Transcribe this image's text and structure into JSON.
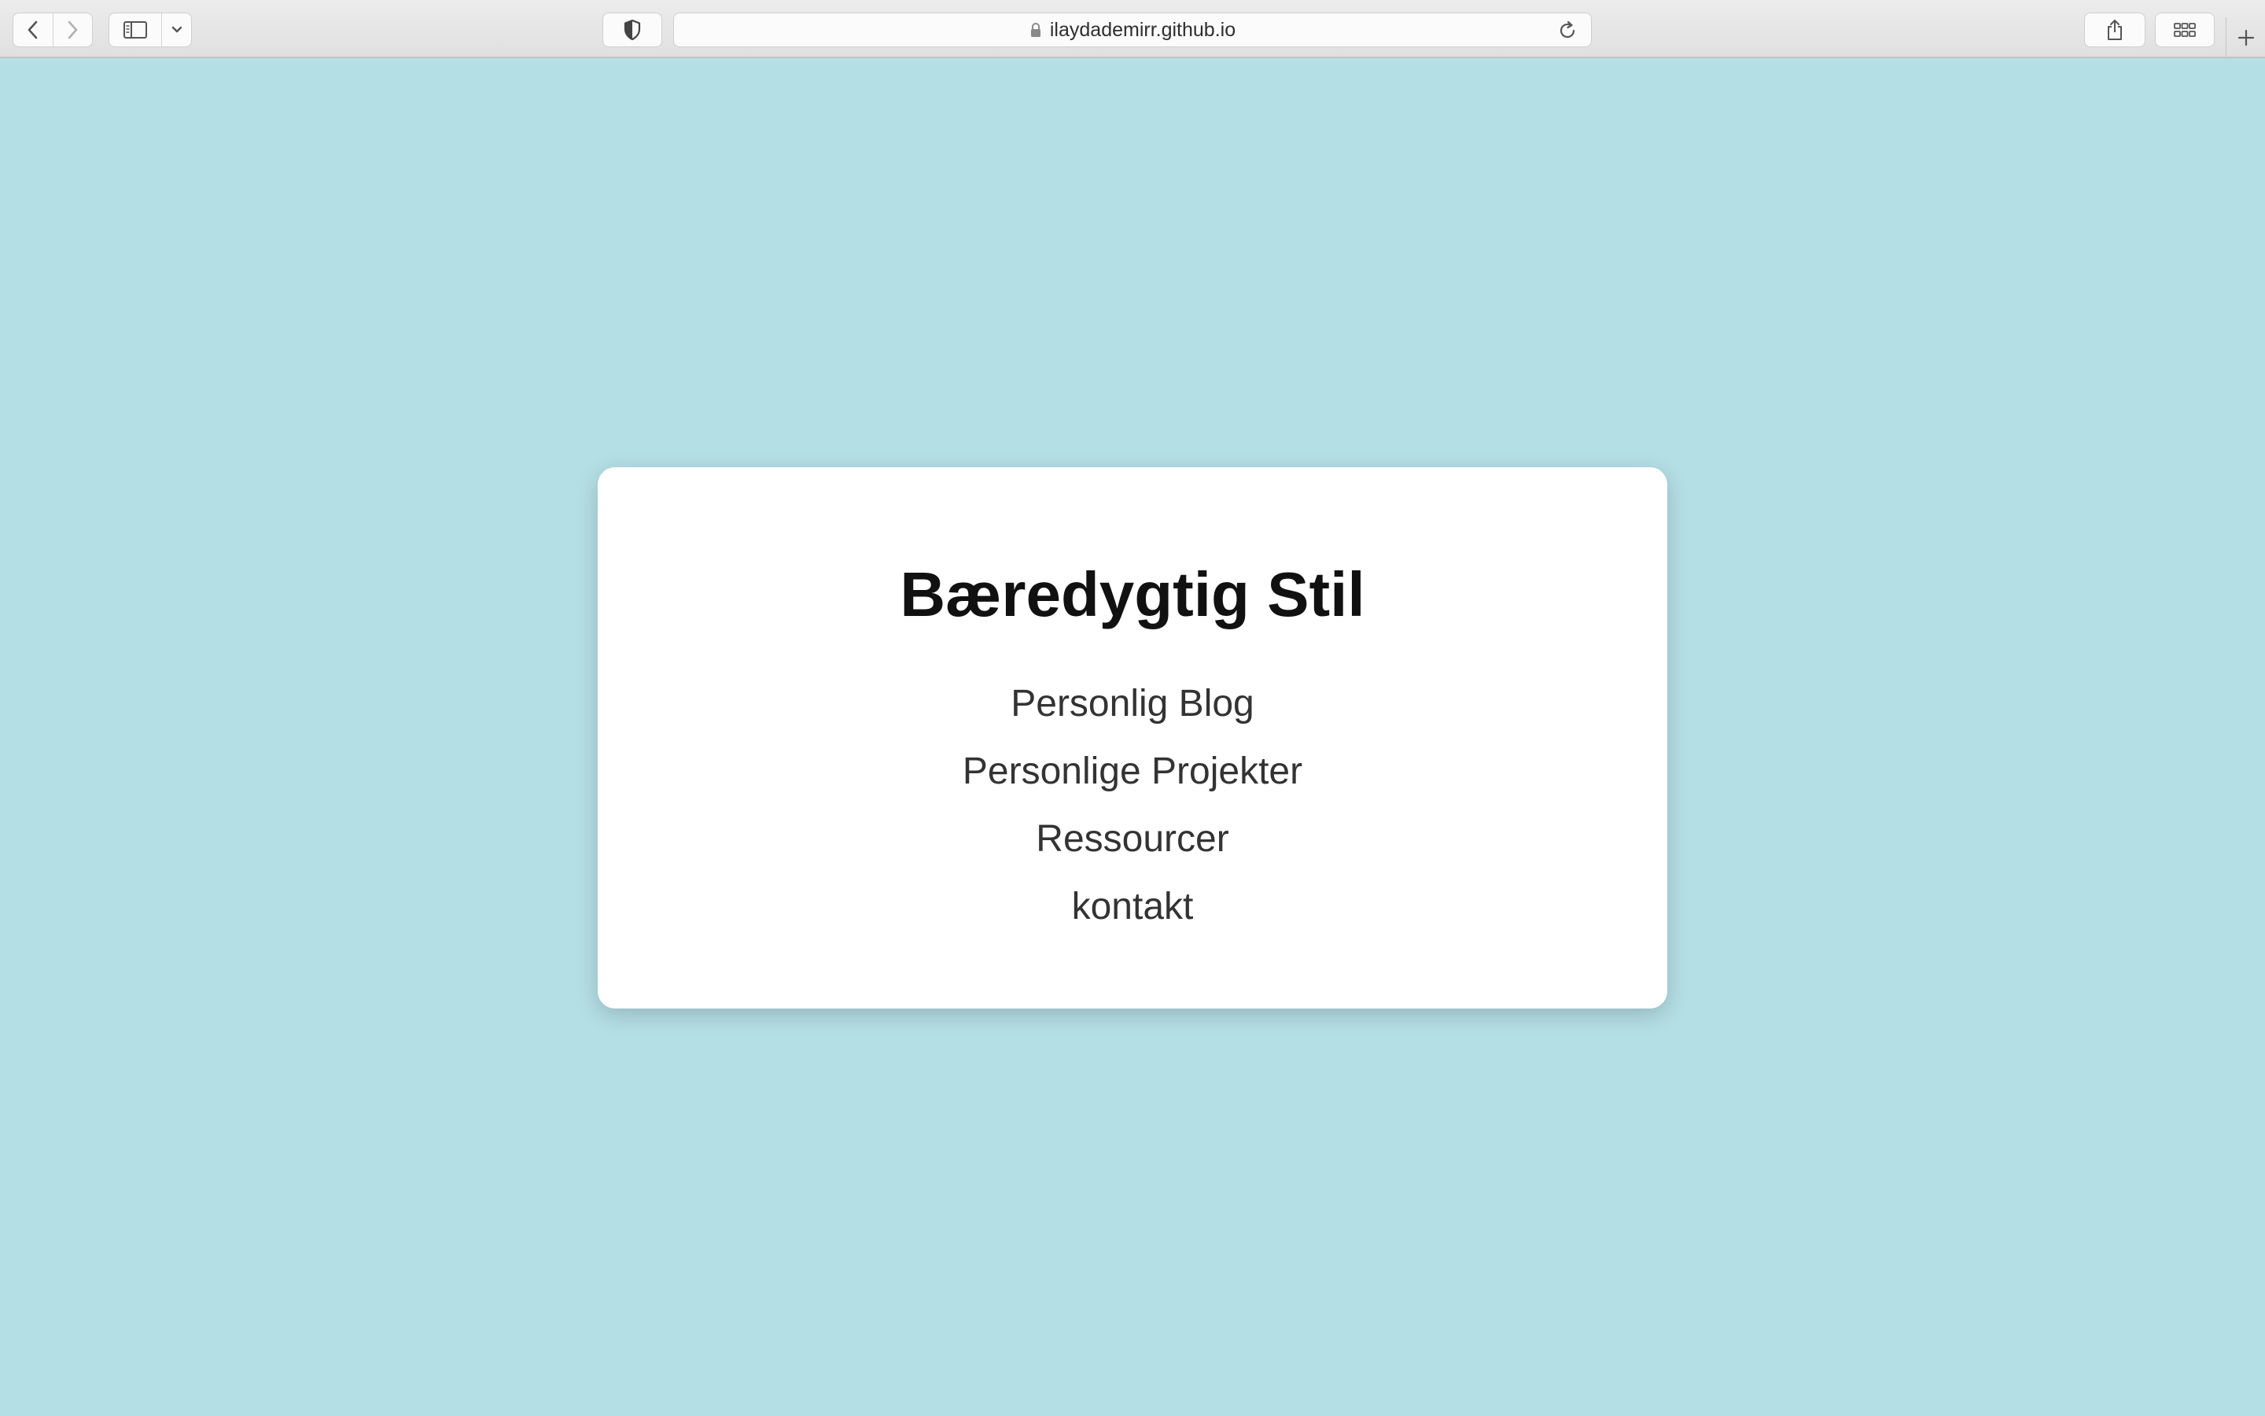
{
  "browser": {
    "url": "ilaydademirr.github.io",
    "icons": {
      "back": "chevron-left-icon",
      "forward": "chevron-right-icon",
      "sidebar": "sidebar-icon",
      "sidebar_menu": "chevron-down-icon",
      "privacy": "shield-icon",
      "lock": "lock-icon",
      "reload": "reload-icon",
      "share": "share-icon",
      "tabs": "tab-overview-icon",
      "new_tab": "plus-icon"
    }
  },
  "page": {
    "background_color": "#b4dfe5",
    "card_color": "#ffffff",
    "title": "Bæredygtig Stil",
    "nav": [
      {
        "label": "Personlig Blog"
      },
      {
        "label": "Personlige Projekter"
      },
      {
        "label": "Ressourcer"
      },
      {
        "label": "kontakt"
      }
    ]
  }
}
